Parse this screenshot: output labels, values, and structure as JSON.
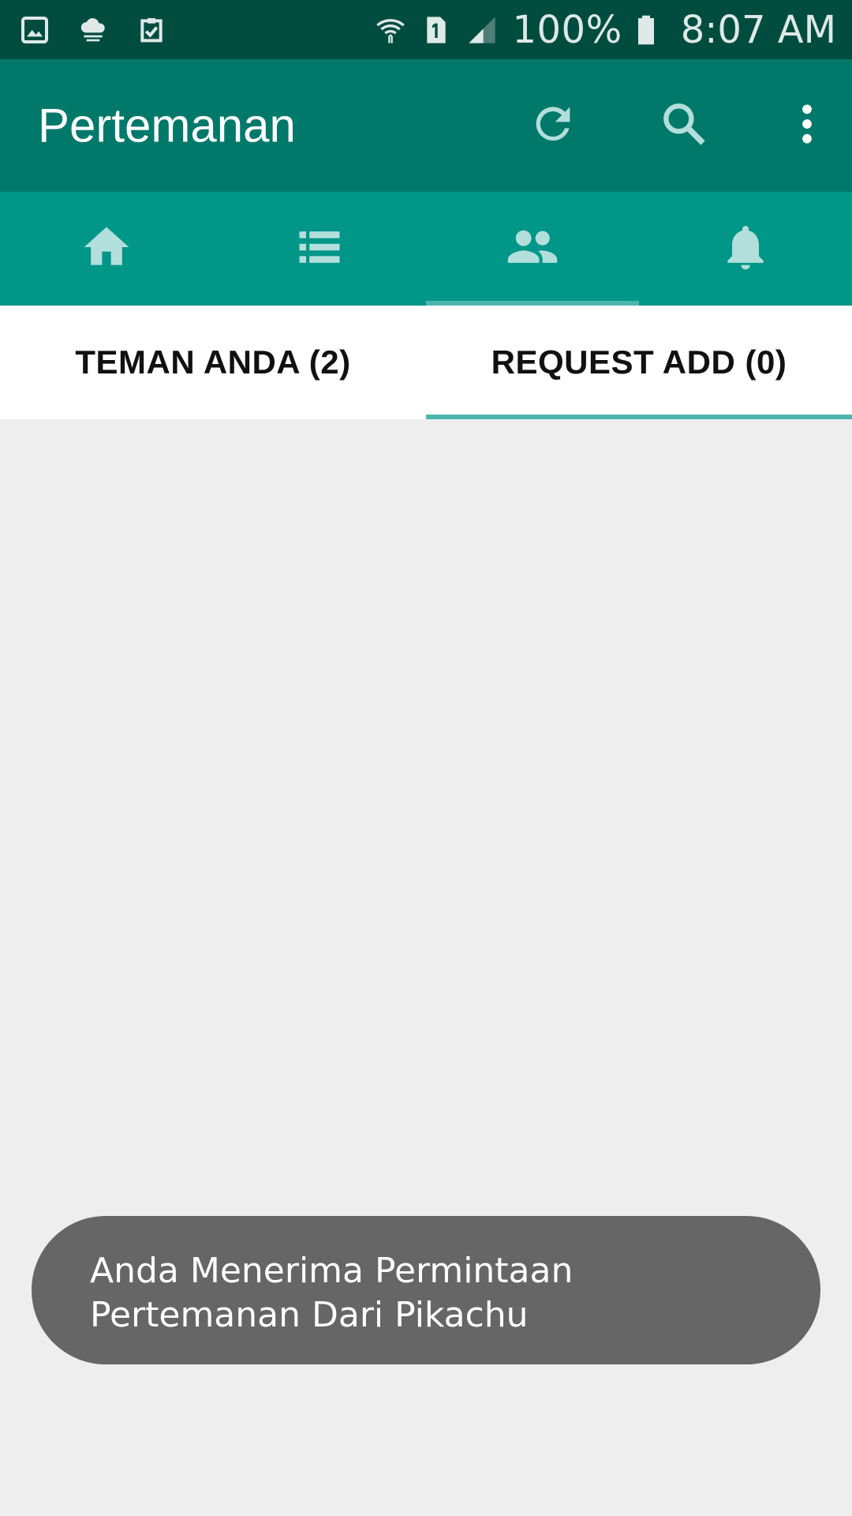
{
  "status_bar": {
    "left_icons": [
      "gallery-icon",
      "cloud-icon",
      "clipboard-check-icon"
    ],
    "right_icons": [
      "wifi-icon",
      "sim-1-icon",
      "signal-icon"
    ],
    "battery": "100%",
    "time": "8:07 AM"
  },
  "app_bar": {
    "title": "Pertemanan",
    "actions": [
      "refresh-icon",
      "search-icon",
      "more-vert-icon"
    ]
  },
  "icon_tabs": [
    {
      "icon": "home-icon",
      "active": false
    },
    {
      "icon": "list-icon",
      "active": false
    },
    {
      "icon": "people-icon",
      "active": true
    },
    {
      "icon": "bell-icon",
      "active": false
    }
  ],
  "text_tabs": [
    {
      "label": "TEMAN ANDA (2)",
      "active": false
    },
    {
      "label": "REQUEST ADD (0)",
      "active": true
    }
  ],
  "toast": {
    "message": "Anda Menerima Permintaan Pertemanan Dari Pikachu"
  },
  "colors": {
    "status_bar": "#004d40",
    "app_bar": "#00796b",
    "tab_bar": "#009688",
    "indicator": "#4db6ac",
    "icon_tint": "#b2dfdb",
    "background": "#eeeeee",
    "toast": "#666666"
  }
}
